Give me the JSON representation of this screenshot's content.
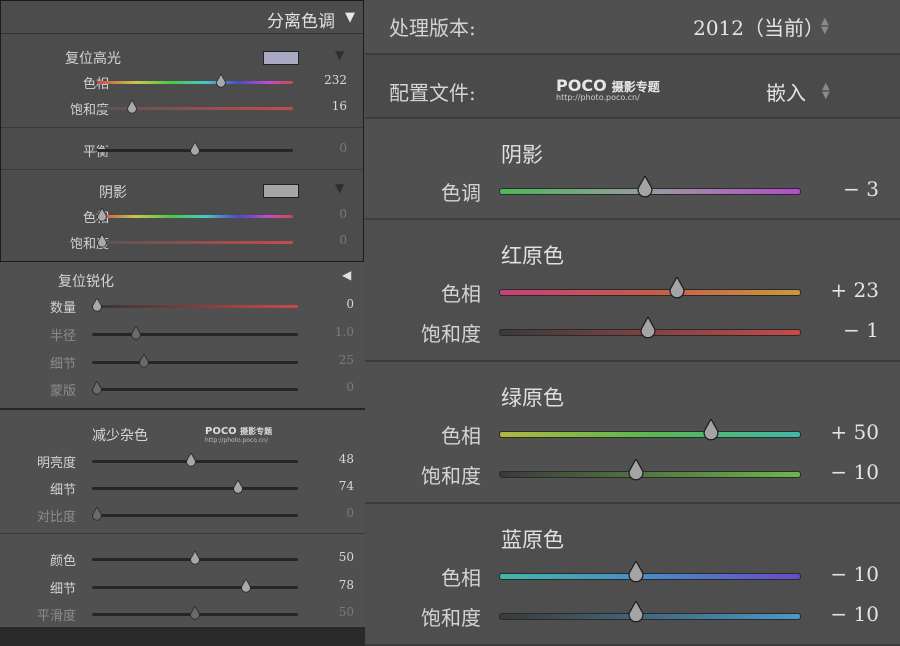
{
  "split_toning": {
    "title": "分离色调",
    "collapse_arrow": "▼",
    "highlights": {
      "label": "复位高光",
      "swatch": "#a9a9c3",
      "hue": {
        "label": "色相",
        "value": "232",
        "pos": 0.64
      },
      "sat": {
        "label": "饱和度",
        "value": "16",
        "pos": 0.16
      }
    },
    "balance": {
      "label": "平衡",
      "value": "0",
      "pos": 0.5
    },
    "shadows": {
      "label": "阴影",
      "swatch": "#a6a6a6",
      "hue": {
        "label": "色相",
        "value": "0",
        "pos": 0.0
      },
      "sat": {
        "label": "饱和度",
        "value": "0",
        "pos": 0.0
      }
    }
  },
  "sharpening": {
    "title": "复位锐化",
    "arrow": "◀",
    "sliders": [
      {
        "label": "数量",
        "value": "0",
        "pos": 0.0,
        "dim": false
      },
      {
        "label": "半径",
        "value": "1.0",
        "pos": 0.2,
        "dim": true
      },
      {
        "label": "细节",
        "value": "25",
        "pos": 0.24,
        "dim": true
      },
      {
        "label": "蒙版",
        "value": "0",
        "pos": 0.0,
        "dim": true
      }
    ]
  },
  "noise_reduction": {
    "title": "减少杂色",
    "watermark": {
      "brand": "POCO",
      "tag": "摄影专题",
      "url": "http://photo.poco.cn/"
    },
    "luminance": [
      {
        "label": "明亮度",
        "value": "48",
        "pos": 0.48,
        "dim": false
      },
      {
        "label": "细节",
        "value": "74",
        "pos": 0.72,
        "dim": false
      },
      {
        "label": "对比度",
        "value": "0",
        "pos": 0.0,
        "dim": true
      }
    ],
    "color": [
      {
        "label": "颜色",
        "value": "50",
        "pos": 0.5,
        "dim": false
      },
      {
        "label": "细节",
        "value": "78",
        "pos": 0.76,
        "dim": false
      },
      {
        "label": "平滑度",
        "value": "50",
        "pos": 0.5,
        "dim": true
      }
    ]
  },
  "process": {
    "label": "处理版本:",
    "value": "2012（当前）"
  },
  "profile": {
    "label": "配置文件:",
    "value": "嵌入",
    "watermark": {
      "brand": "POCO",
      "tag": "摄影专题",
      "url": "http://photo.poco.cn/"
    }
  },
  "calibration": [
    {
      "title": "阴影",
      "sliders": [
        {
          "label": "色调",
          "value": "− 3",
          "pos": 0.485,
          "grad": "linear-gradient(90deg,#49b85a,#9a9aa0 50%,#b24cc8)"
        }
      ]
    },
    {
      "title": "红原色",
      "sliders": [
        {
          "label": "色相",
          "value": "+ 23",
          "pos": 0.6,
          "grad": "linear-gradient(90deg,#c8407a,#c85a4a 50%,#c89a3a)"
        },
        {
          "label": "饱和度",
          "value": "− 1",
          "pos": 0.495,
          "grad": "linear-gradient(90deg,#3a3a3a,#c84a4a)"
        }
      ]
    },
    {
      "title": "绿原色",
      "sliders": [
        {
          "label": "色相",
          "value": "+ 50",
          "pos": 0.72,
          "grad": "linear-gradient(90deg,#b0b840,#5ab850 50%,#40b8a8)"
        },
        {
          "label": "饱和度",
          "value": "− 10",
          "pos": 0.455,
          "grad": "linear-gradient(90deg,#3a3a3a,#6cb84a)"
        }
      ]
    },
    {
      "title": "蓝原色",
      "sliders": [
        {
          "label": "色相",
          "value": "− 10",
          "pos": 0.455,
          "grad": "linear-gradient(90deg,#40b8a8,#4a8ac8 50%,#6a4ac8)"
        },
        {
          "label": "饱和度",
          "value": "− 10",
          "pos": 0.455,
          "grad": "linear-gradient(90deg,#3a3a3a,#4a9ac8)"
        }
      ]
    }
  ]
}
